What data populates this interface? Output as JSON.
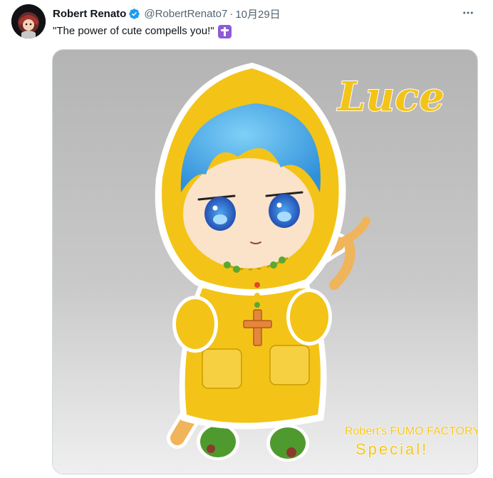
{
  "post": {
    "author_name": "Robert Renato",
    "handle": "@RobertRenato7",
    "separator": "·",
    "date": "10月29日",
    "text": "\"The power of cute compells you!\"",
    "emoji": "latin-cross-emoji"
  },
  "image": {
    "title_text": "Luce",
    "signature_line1": "Robert's FUMO FACTORY",
    "signature_line2": "Special!"
  },
  "colors": {
    "verified_badge": "#1d9bf0",
    "raincoat": "#f3c417",
    "hair": "#4aa8e8",
    "background_gradient_top": "#b6b6b6",
    "background_gradient_bottom": "#eeeeee"
  },
  "icons": [
    "verified-badge-icon",
    "more-options-icon",
    "latin-cross-emoji"
  ]
}
